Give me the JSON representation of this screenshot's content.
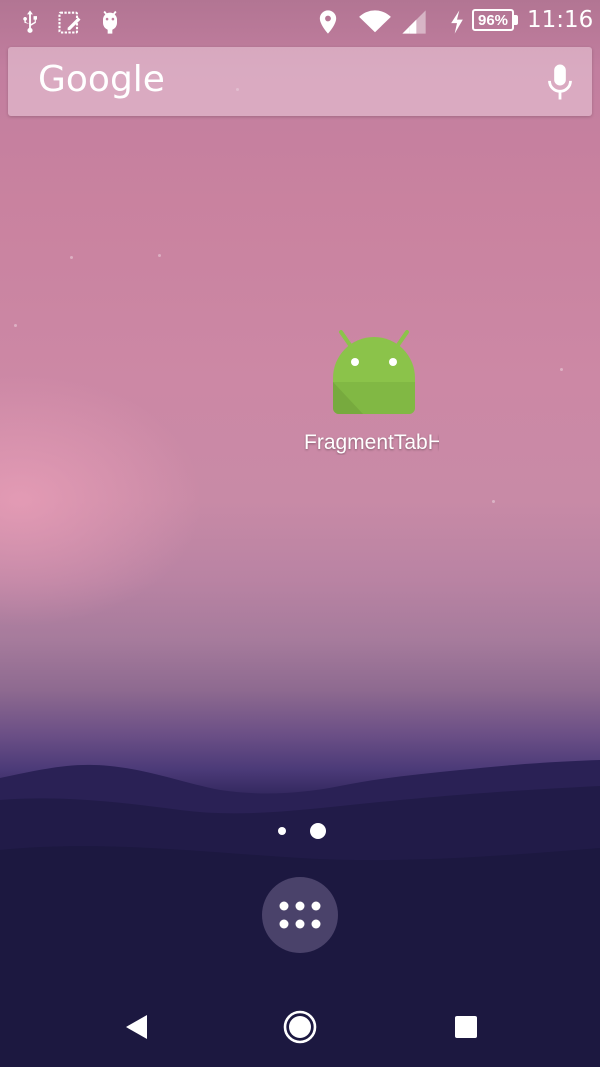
{
  "status_bar": {
    "left_icons": [
      "usb-icon",
      "notes-icon",
      "android-debug-icon"
    ],
    "right_icons": [
      "location-icon",
      "wifi-icon",
      "cell-signal-icon",
      "charging-icon"
    ],
    "battery_text": "96%",
    "time": "11:16"
  },
  "search": {
    "logo_text": "Google",
    "mic_icon": "microphone-icon"
  },
  "home": {
    "apps": [
      {
        "label": "FragmentTabH",
        "icon": "android-app-icon",
        "icon_color": "#8bc34a"
      }
    ]
  },
  "page_indicator": {
    "total": 2,
    "current": 2
  },
  "dock": {
    "all_apps_icon": "app-drawer-icon"
  },
  "navigation": {
    "back_icon": "back-icon",
    "home_icon": "home-icon",
    "recents_icon": "recents-icon"
  },
  "colors": {
    "sky_top": "#b27593",
    "sky_mid": "#cc88a5",
    "mountains": "#1d1940",
    "app_green": "#8bc34a"
  }
}
